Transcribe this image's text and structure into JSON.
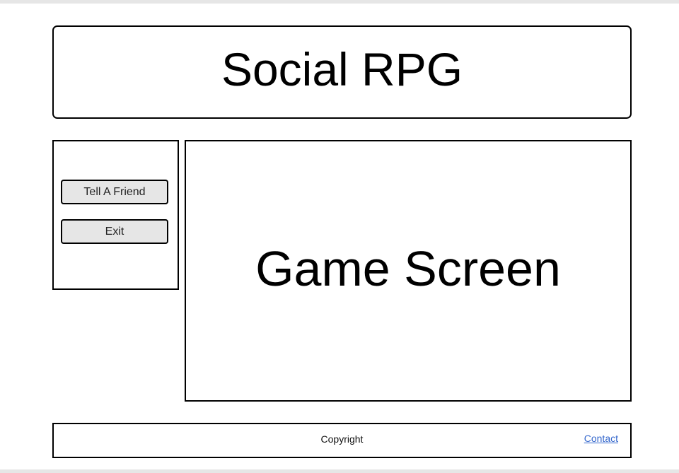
{
  "header": {
    "title": "Social RPG"
  },
  "sidebar": {
    "buttons": [
      {
        "label": "Tell A Friend"
      },
      {
        "label": "Exit"
      }
    ]
  },
  "main": {
    "placeholder": "Game Screen"
  },
  "footer": {
    "copyright": "Copyright",
    "contact_link": "Contact"
  },
  "colors": {
    "border": "#000000",
    "button_bg": "#e6e6e6",
    "link": "#3366cc"
  }
}
